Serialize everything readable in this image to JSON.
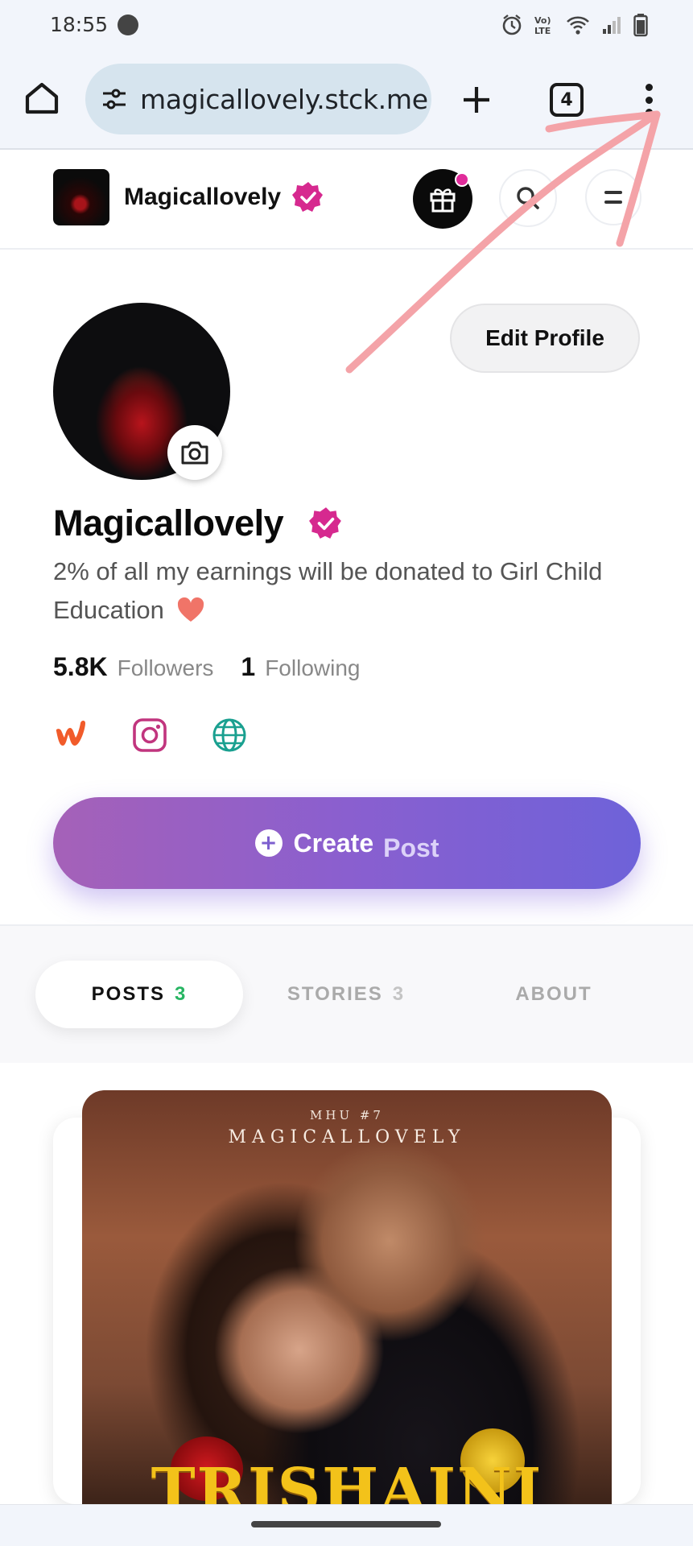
{
  "status_bar": {
    "time": "18:55",
    "icons": [
      "alarm-icon",
      "volte-icon",
      "wifi-icon",
      "signal-icon",
      "battery-icon"
    ],
    "volte_text": "Vo) LTE"
  },
  "browser": {
    "url": "magicallovely.stck.me",
    "tab_count": "4",
    "icons": [
      "home-icon",
      "site-settings-icon",
      "new-tab-icon",
      "tab-switcher-icon",
      "more-vert-icon"
    ]
  },
  "site_header": {
    "name": "Magicallovely",
    "icons": [
      "verified-badge-icon",
      "gift-icon",
      "search-icon",
      "menu-icon"
    ]
  },
  "profile": {
    "edit_label": "Edit Profile",
    "name": "Magicallovely",
    "bio": "2% of all my earnings will be donated to Girl Child Education",
    "bio_emoji": "heart-emoji",
    "followers_count": "5.8K",
    "followers_label": "Followers",
    "following_count": "1",
    "following_label": "Following",
    "social_links": [
      "wattpad-icon",
      "instagram-icon",
      "website-globe-icon"
    ]
  },
  "create": {
    "label": "Create",
    "post_label": "Post"
  },
  "tabs": [
    {
      "label": "POSTS",
      "count": "3",
      "active": true
    },
    {
      "label": "STORIES",
      "count": "3",
      "active": false
    },
    {
      "label": "ABOUT",
      "count": "",
      "active": false
    }
  ],
  "post": {
    "subtitle": "MHU #7",
    "brand": "MAGICALLOVELY",
    "title": "TRISHAINI"
  },
  "colors": {
    "verified": "#d6298f",
    "create_start": "#a561b8",
    "create_end": "#6e62d9",
    "posts_count": "#27b562",
    "annotation": "#f4a3a8"
  }
}
